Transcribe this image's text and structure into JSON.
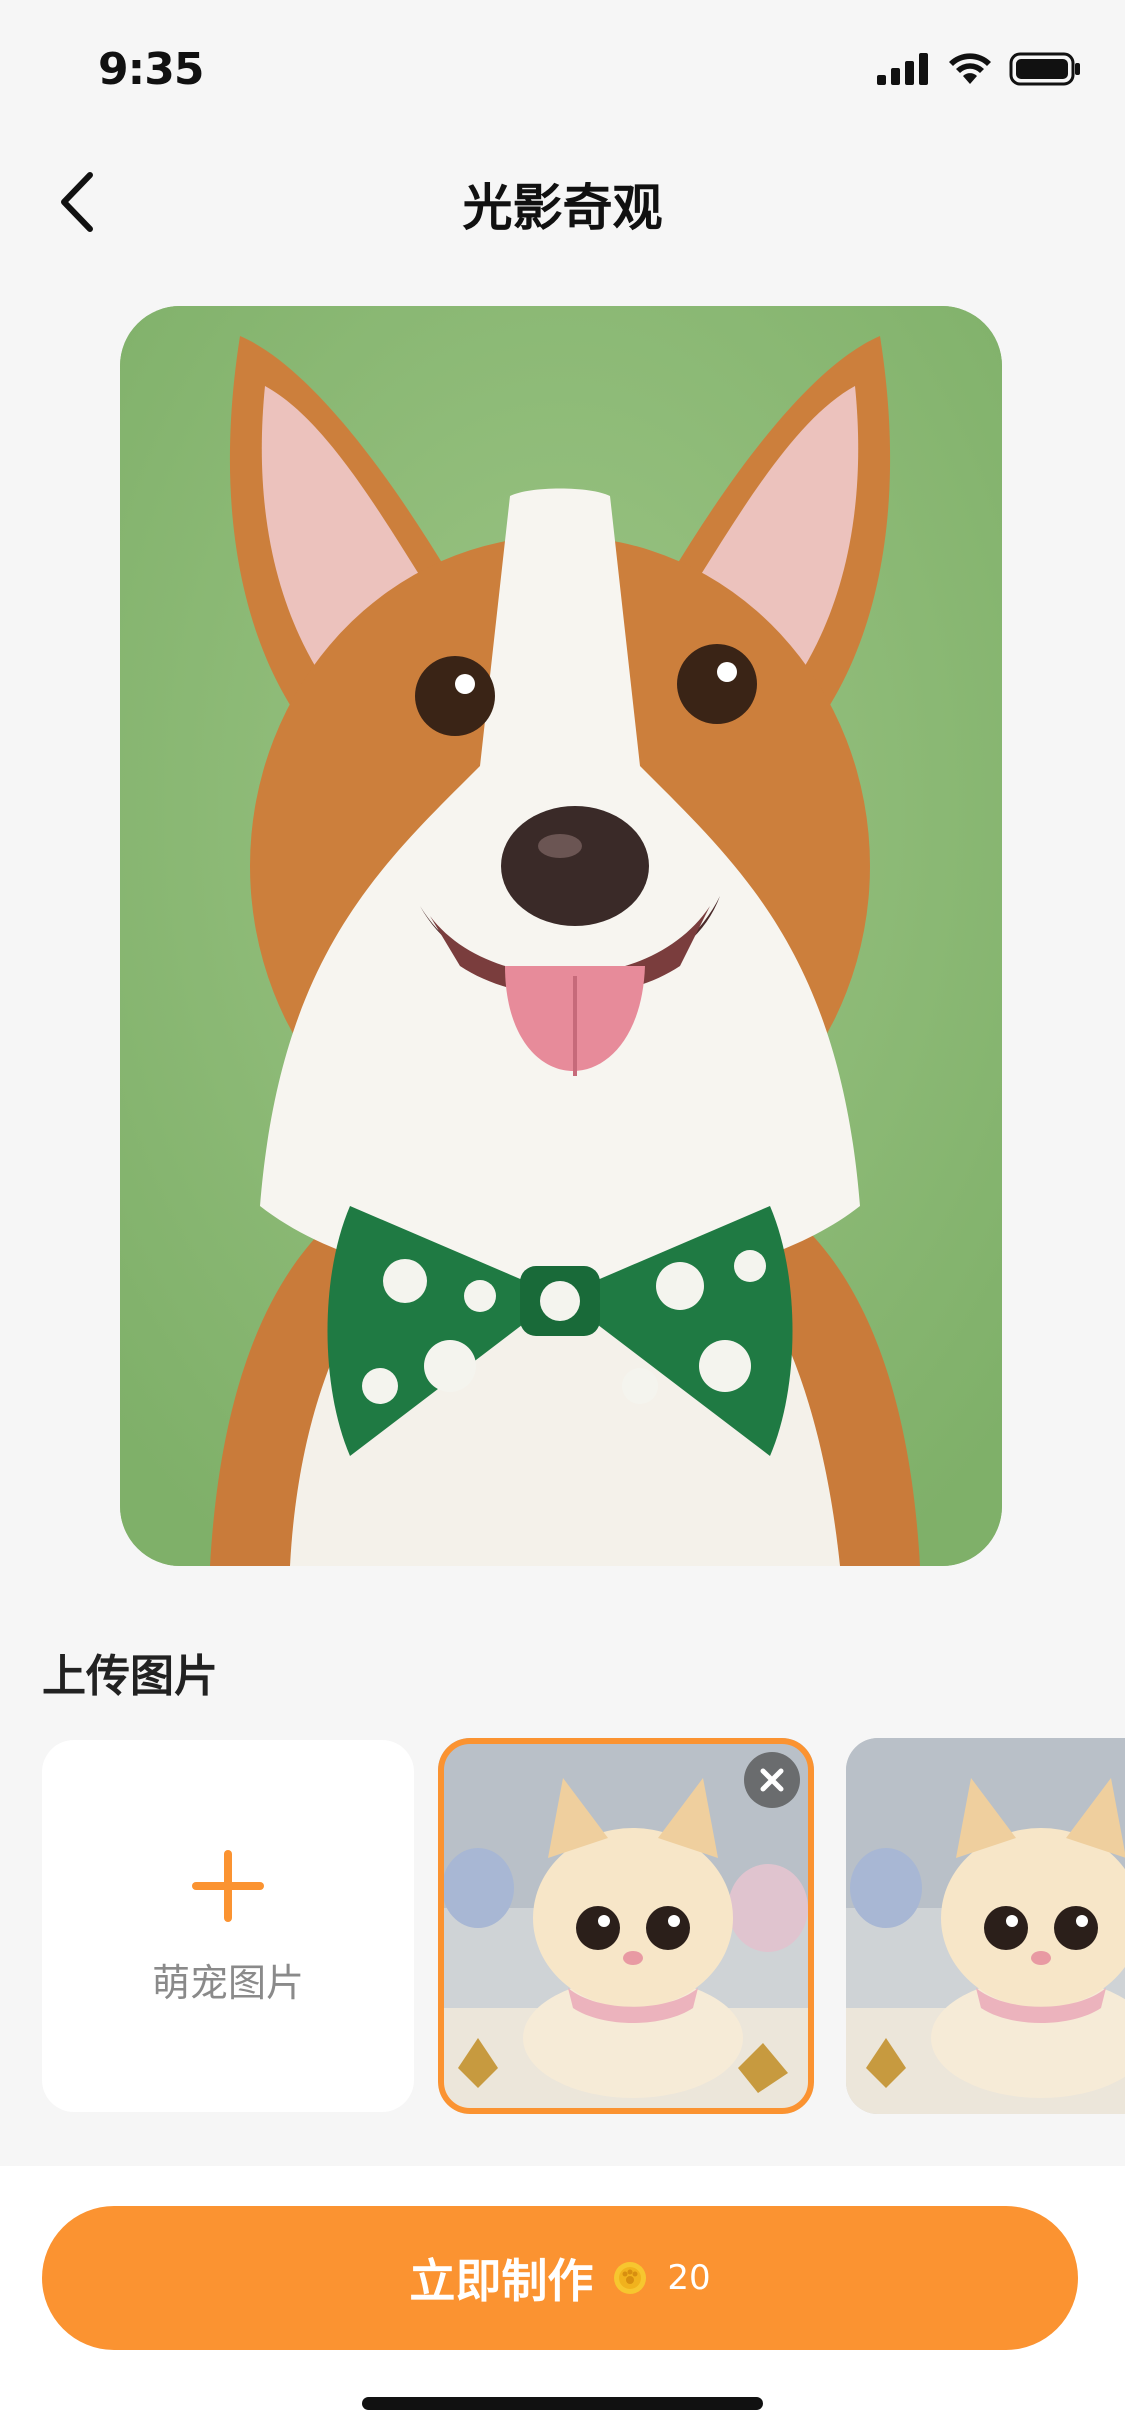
{
  "status_bar": {
    "time": "9:35"
  },
  "nav": {
    "title": "光影奇观"
  },
  "upload_section": {
    "title": "上传图片",
    "add_card_label": "萌宠图片"
  },
  "primary_action": {
    "label": "立即制作",
    "cost": "20",
    "cost_icon": "coin-icon"
  },
  "colors": {
    "accent": "#fb9331",
    "background": "#f6f6f6",
    "card": "#ffffff"
  }
}
